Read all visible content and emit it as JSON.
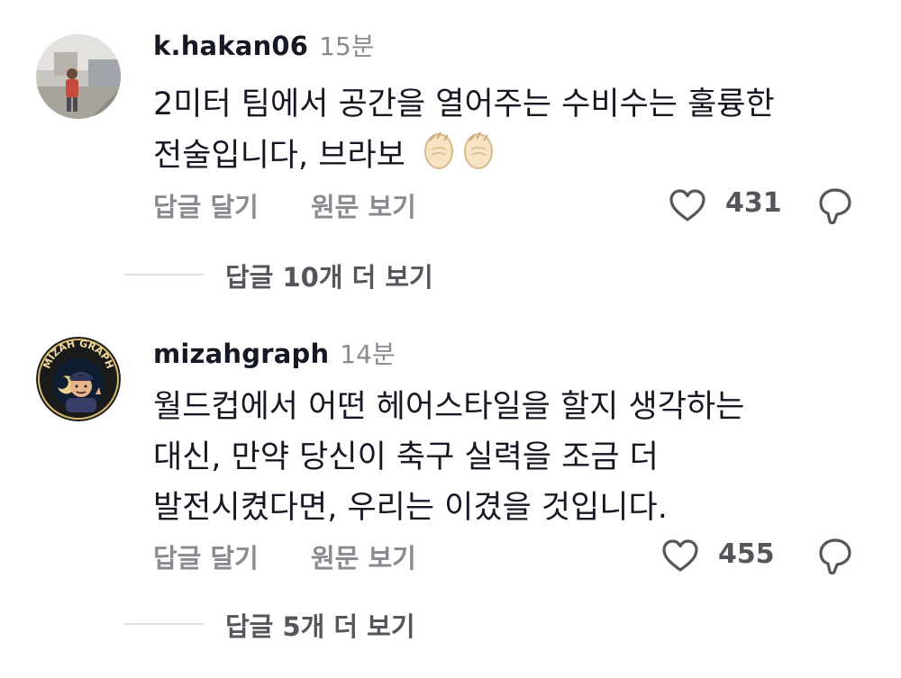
{
  "comments": [
    {
      "username": "k.hakan06",
      "time": "15분",
      "text_line1": "2미터 팀에서 공간을 열어주는 수비수는 훌륭한",
      "text_line2": "전술입니다, 브라보",
      "reply_label": "답글 달기",
      "translate_label": "원문 보기",
      "likes": "431",
      "view_replies": "답글 10개 더 보기"
    },
    {
      "username": "mizahgraph",
      "time": "14분",
      "text_line1": "월드컵에서 어떤 헤어스타일을 할지 생각하는",
      "text_line2": "대신, 만약 당신이 축구 실력을 조금 더",
      "text_line3": "발전시켰다면, 우리는 이겼을 것입니다.",
      "reply_label": "답글 달기",
      "translate_label": "원문 보기",
      "likes": "455",
      "view_replies": "답글 5개 더 보기",
      "avatar_logo_text": "MİZAH GRAPH"
    }
  ],
  "colors": {
    "primary_text": "#161823",
    "secondary_text": "#8a8b91",
    "divider": "#dcdcde"
  }
}
